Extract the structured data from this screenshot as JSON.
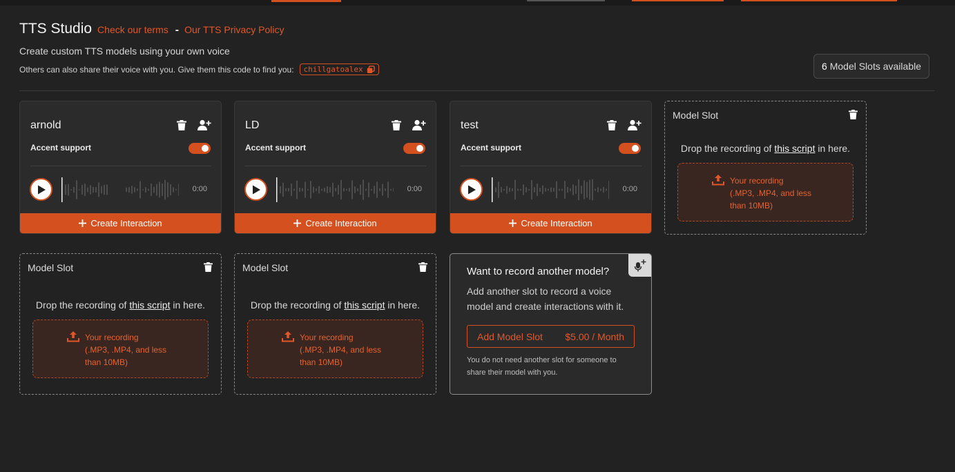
{
  "header": {
    "title": "TTS Studio",
    "terms_link": "Check our terms",
    "separator": "-",
    "privacy_link": "Our TTS Privacy Policy",
    "subtitle": "Create custom TTS models using your own voice",
    "share_text": "Others can also share their voice with you. Give them this code to find you:",
    "share_code": "chillgatoalex",
    "slots_count": "6",
    "slots_label": "Model Slots available"
  },
  "models": [
    {
      "name": "arnold",
      "accent_label": "Accent support",
      "accent_on": true,
      "time": "0:00",
      "create_label": "Create Interaction"
    },
    {
      "name": "LD",
      "accent_label": "Accent support",
      "accent_on": true,
      "time": "0:00",
      "create_label": "Create Interaction"
    },
    {
      "name": "test",
      "accent_label": "Accent support",
      "accent_on": true,
      "time": "0:00",
      "create_label": "Create Interaction"
    }
  ],
  "slot": {
    "title": "Model Slot",
    "drop_before": "Drop the recording of",
    "drop_link": "this script",
    "drop_after": "in here.",
    "upload_line1": "Your recording",
    "upload_line2": "(.MP3, .MP4, and less",
    "upload_line3": "than 10MB)"
  },
  "promo": {
    "title": "Want to record another model?",
    "description": "Add another slot to record a voice model and create interactions with it.",
    "add_label": "Add Model Slot",
    "price": "$5.00 / Month",
    "note": "You do not need another slot for someone to share their model with you."
  },
  "colors": {
    "accent": "#d4501f",
    "background": "#222222",
    "card": "#2b2b2b"
  },
  "icons": [
    "trash-icon",
    "add-user-icon",
    "play-icon",
    "plus-icon",
    "upload-icon",
    "copy-icon",
    "microphone-plus-icon"
  ]
}
